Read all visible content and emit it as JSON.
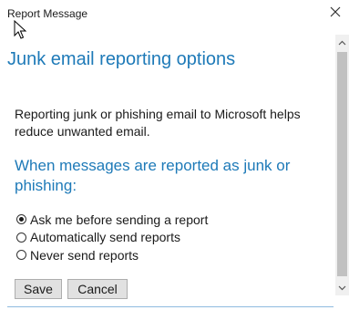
{
  "window": {
    "title": "Report Message"
  },
  "icons": {
    "close": "close-icon",
    "cursor": "mouse-cursor-icon",
    "scroll_up": "chevron-up-icon",
    "scroll_down": "chevron-down-icon"
  },
  "main": {
    "heading": "Junk email reporting options",
    "description": "Reporting junk or phishing email to Microsoft helps reduce unwanted email.",
    "subheading": "When messages are reported as junk or phishing:",
    "options": [
      {
        "label": "Ask me before sending a report",
        "selected": true
      },
      {
        "label": "Automatically send reports",
        "selected": false
      },
      {
        "label": "Never send reports",
        "selected": false
      }
    ],
    "buttons": {
      "save": "Save",
      "cancel": "Cancel"
    }
  },
  "colors": {
    "accent": "#1e7ab8",
    "text": "#1a1a1a",
    "button_bg": "#e1e1e1",
    "scrollbar_track": "#f0f0f0",
    "scrollbar_thumb": "#c1c1c1"
  }
}
